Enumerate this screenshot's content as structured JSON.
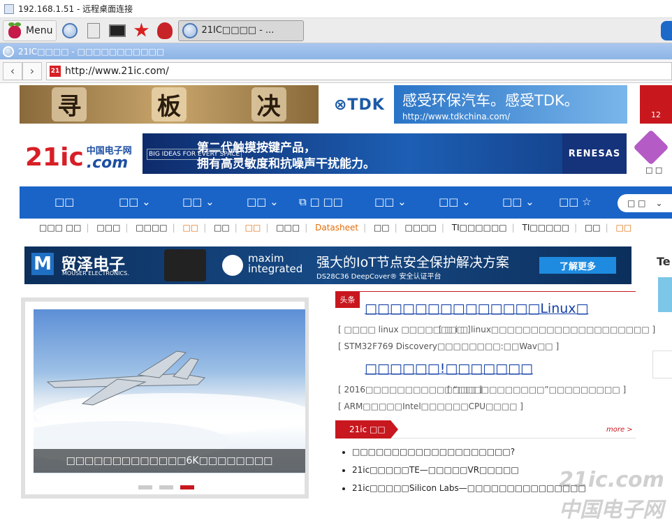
{
  "remote_window": {
    "title": "192.168.1.51 - 远程桌面连接"
  },
  "taskbar": {
    "menu_label": "Menu",
    "active_window_label": "21IC□□□□ - ..."
  },
  "browser": {
    "title": "21IC□□□□ - □□□□□□□□□□□",
    "url": "http://www.21ic.com/",
    "favicon_text": "21"
  },
  "ads": {
    "xunban": [
      "寻",
      "板",
      "决"
    ],
    "tdk_logo": "⊗TDK",
    "tdk_headline": "感受环保汽车。感受TDK。",
    "tdk_url": "http://www.tdkchina.com/",
    "red_corner": "12",
    "renesas_badge": "BIG IDEAS FOR EVERY SPACE",
    "renesas_line1": "第二代触摸按键产品，",
    "renesas_line2": "拥有高灵敏度和抗噪声干扰能力。",
    "renesas_brand": "RENESAS",
    "mouser_name": "贸泽电子",
    "mouser_en": "MOUSER ELECTRONICS.",
    "maxim": "maxim integrated",
    "mouser_headline": "强大的IoT节点安全保护解决方案",
    "mouser_sub": "DS28C36 DeepCover® 安全认证平台",
    "mouser_button": "了解更多"
  },
  "logo": {
    "mark": "21ic",
    "cn": "中国电子网",
    "com": ".com"
  },
  "side_key_label": "□ □",
  "nav": {
    "items": [
      "□□",
      "□□",
      "□□",
      "□□",
      "□ □□",
      "□□",
      "□□",
      "□□",
      "□□"
    ],
    "search_placeholder": "□ □"
  },
  "subnav": [
    "□□□ □□",
    "□□□",
    "□□□□",
    "□□",
    "□□",
    "□□",
    "□□□",
    "Datasheet",
    "□□",
    "□□□□",
    "TI□□□□□□",
    "TI□□□□□",
    "□□",
    "□□"
  ],
  "carousel": {
    "caption": "□□□□□□□□□□□□□6K□□□□□□□□"
  },
  "headlines": {
    "tag": "头条",
    "lead1": "□□□□□□□□□□□□□□Linux□",
    "sub1a": "[ □□□□ linux □□□□□□□□ ]",
    "sub1b": "[ □ i □ linux□□□□□□□□□□□□□□□□□□□□ ]",
    "sub1c": "[ STM32F769 Discovery□□□□□□□□:□□Wav□□ ]",
    "lead2": "□□□□□□!□□□□□□□",
    "sub2a": "[ 2016□□□□□□□□□□□□□□ ]",
    "sub2b": "[ “□□□□□□□□□□□”□□□□□□□□□ ]",
    "sub2c": "[ ARM□□□□□Intel□□□□□□CPU□□□□ ]"
  },
  "section": {
    "tab": "21ic □□",
    "more": "more >",
    "items": [
      "□□□□□□□□□□□□□□□□□□□□?",
      "21ic□□□□□TE—□□□□□VR□□□□□",
      "21ic□□□□□Silicon Labs—□□□□□□□□□□□□□□□"
    ]
  },
  "watermark": "21ic.com 中国电子网"
}
